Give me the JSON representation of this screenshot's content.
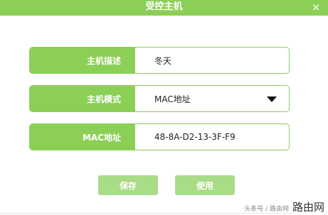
{
  "window": {
    "title": "受控主机",
    "close_symbol": "×"
  },
  "form": {
    "fields": [
      {
        "label": "主机描述",
        "value": "冬天"
      },
      {
        "label": "主机模式",
        "value": "MAC地址"
      },
      {
        "label": "MAC地址",
        "value": "48-8A-D2-13-3F-F9"
      }
    ]
  },
  "buttons": {
    "save_label": "保存",
    "apply_label": "使用"
  },
  "watermark": {
    "prefix": "头条号 / 路由网",
    "logo": "路由网"
  },
  "colors": {
    "accent": "#8bcf57",
    "button": "#a9dc87"
  }
}
